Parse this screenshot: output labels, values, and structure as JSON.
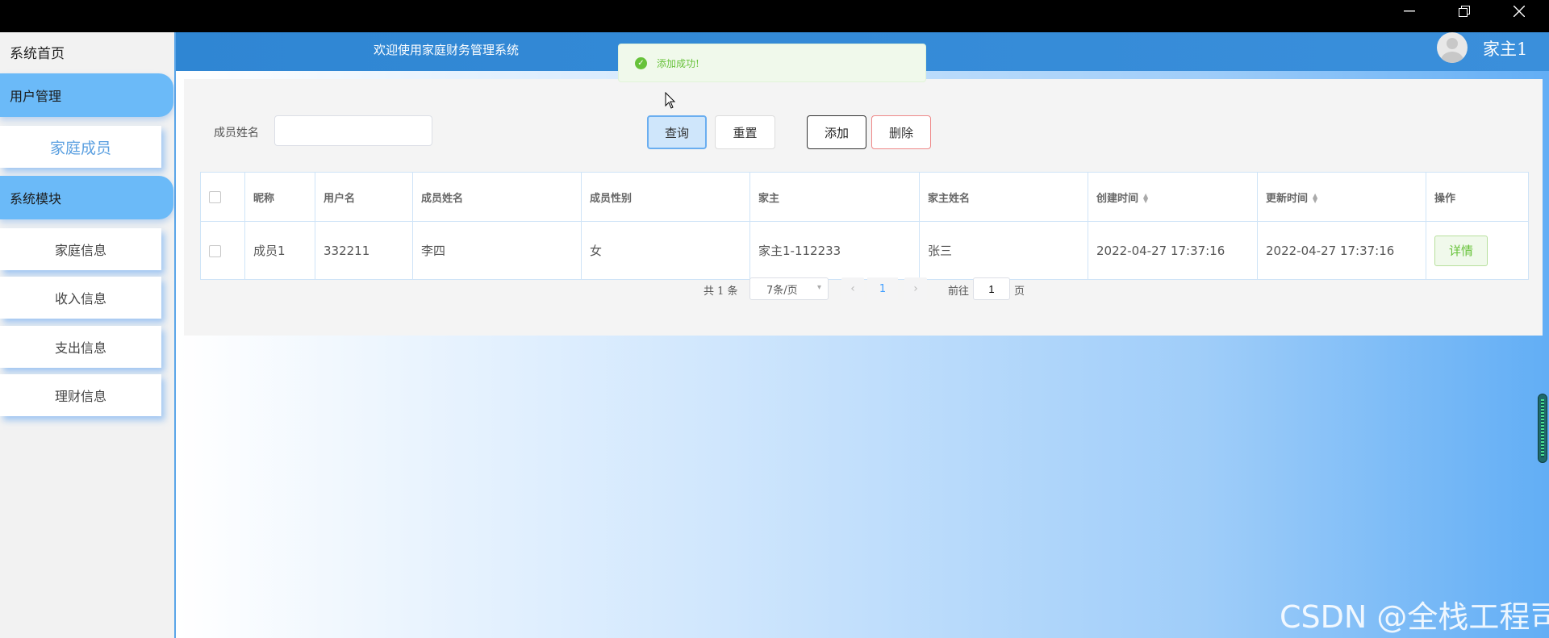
{
  "window": {
    "minimize_icon": "minimize-icon",
    "maximize_icon": "restore-icon",
    "close_icon": "close-icon"
  },
  "sidebar": {
    "home": "系统首页",
    "groups": [
      {
        "label": "用户管理",
        "items": [
          {
            "label": "家庭成员",
            "active": true
          }
        ]
      },
      {
        "label": "系统模块",
        "items": [
          {
            "label": "家庭信息"
          },
          {
            "label": "收入信息"
          },
          {
            "label": "支出信息"
          },
          {
            "label": "理财信息"
          }
        ]
      }
    ]
  },
  "header": {
    "title": "欢迎使用家庭财务管理系统",
    "user_name": "家主1"
  },
  "toast": {
    "message": "添加成功!"
  },
  "search": {
    "label": "成员姓名",
    "value": ""
  },
  "buttons": {
    "query": "查询",
    "reset": "重置",
    "add": "添加",
    "delete": "删除"
  },
  "table": {
    "columns": [
      "昵称",
      "用户名",
      "成员姓名",
      "成员性别",
      "家主",
      "家主姓名",
      "创建时间",
      "更新时间",
      "操作"
    ],
    "rows": [
      {
        "nickname": "成员1",
        "username": "332211",
        "member_name": "李四",
        "gender": "女",
        "head": "家主1-112233",
        "head_name": "张三",
        "created": "2022-04-27 17:37:16",
        "updated": "2022-04-27 17:37:16",
        "action": "详情"
      }
    ]
  },
  "pagination": {
    "total": "共 1 条",
    "page_size": "7条/页",
    "current_page": "1",
    "goto_label": "前往",
    "goto_value": "1",
    "goto_suffix": "页"
  },
  "watermark": "CSDN @全栈工程司",
  "colors": {
    "header": "#2f86d3",
    "accent": "#6bbaf8",
    "success": "#67c23a",
    "danger": "#e88888"
  }
}
